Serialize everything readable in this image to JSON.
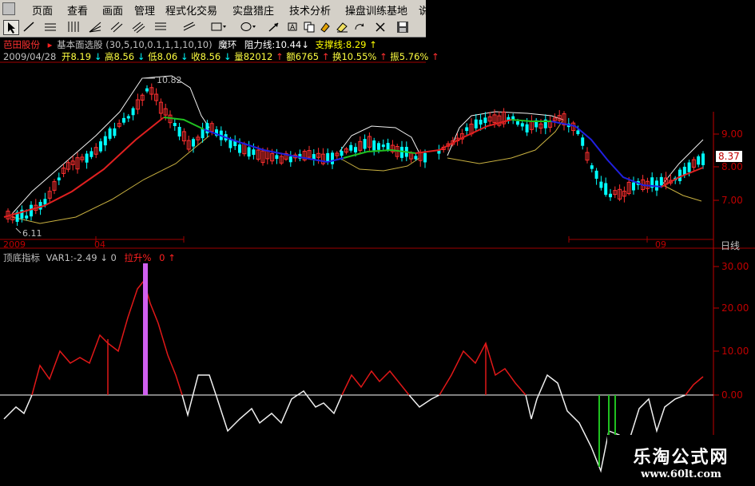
{
  "menu": {
    "items": [
      "页面",
      "查看",
      "画面",
      "管理",
      "程式化交易",
      "实盘猎庄",
      "技术分析",
      "操盘训练基地",
      "说"
    ]
  },
  "toolbar": {
    "icons": [
      "cursor-icon",
      "draw-line-icon",
      "horizontal-line-icon",
      "parallel-lines-icon",
      "fan-lines-icon",
      "rectangle-icon",
      "ellipse-icon",
      "arrow-icon",
      "text-tool-icon",
      "clear-icon",
      "eraser-icon",
      "save-icon"
    ]
  },
  "header": {
    "stock_name": "芭田股份",
    "formula_label": "基本面选股",
    "formula_params": "(30,5,10,0.1,1,1,10,10)",
    "demon_label": "魔环",
    "resistance": "阻力线:10.44↓",
    "support": "支撑线:8.29",
    "support_arrow": "↑",
    "date": "2009/04/28",
    "open": "开8.19",
    "open_arrow": "↓",
    "high": "高8.56",
    "high_arrow": "↓",
    "low": "低8.06",
    "low_arrow": "↓",
    "close": "收8.56",
    "close_arrow": "↓",
    "volume": "量82012",
    "volume_arrow": "↑",
    "amount": "额6765",
    "amount_arrow": "↑",
    "turnover": "换10.55%",
    "turnover_arrow": "↑",
    "amplitude": "振5.76%",
    "amplitude_arrow": "↑"
  },
  "main_chart": {
    "price_labels": [
      "9.00",
      "8.00",
      "7.00"
    ],
    "current_price": "8.37",
    "max_label": "10.82",
    "min_label": "6.11",
    "x_labels": [
      "2009",
      "04",
      "09"
    ],
    "period": "日线",
    "colors": {
      "up": "#ff3030",
      "down": "#00ffff",
      "ma_red": "#e02020",
      "ma_green": "#20c020",
      "ma_blue": "#2020e0",
      "ring_white": "#f0f0f0",
      "ring_yellow": "#c8b040",
      "axis": "#c00000"
    }
  },
  "sub_chart": {
    "name": "顶底指标",
    "var1": "VAR1:-2.49",
    "var1_arrow": "↓",
    "var1_value": "0",
    "pull_label": "拉升%",
    "pull_value": "0",
    "pull_arrow": "↑",
    "axis_labels": [
      "30.00",
      "20.00",
      "10.00",
      "0.00"
    ],
    "colors": {
      "line_red": "#e01818",
      "line_white": "#f0f0f0",
      "bar_purple": "#d060f0",
      "bar_green": "#20c020",
      "zero": "#ffffff"
    }
  },
  "watermark": {
    "title": "乐淘公式网",
    "url": "www.60lt.com"
  }
}
